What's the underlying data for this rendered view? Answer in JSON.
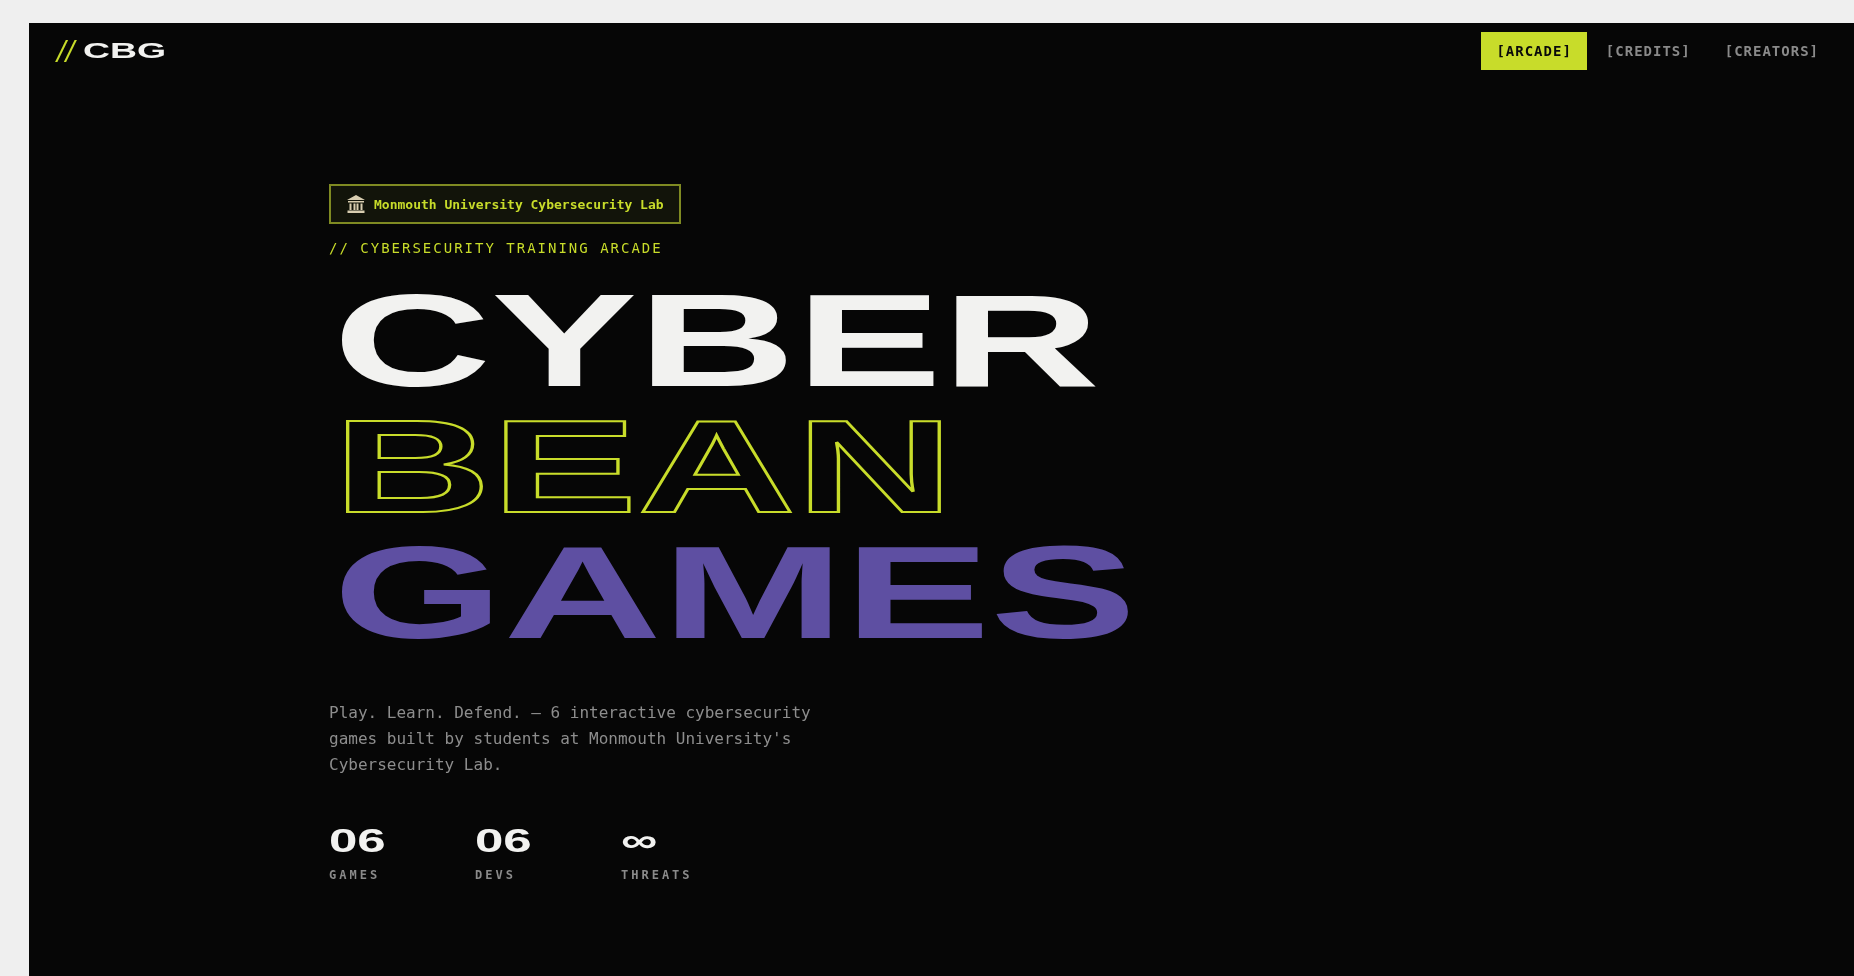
{
  "logo": {
    "mark": "//",
    "text": "CBG"
  },
  "nav": [
    {
      "label": "[ARCADE]",
      "selected": true
    },
    {
      "label": "[CREDITS]",
      "selected": false
    },
    {
      "label": "[CREATORS]",
      "selected": false
    }
  ],
  "badge": {
    "text": "Monmouth University Cybersecurity Lab"
  },
  "eyebrow": "// CYBERSECURITY TRAINING ARCADE",
  "headline": [
    {
      "text": "CYBER",
      "kind": "solid"
    },
    {
      "text": "BEAN",
      "kind": "outline"
    },
    {
      "text": "GAMES",
      "kind": "accent"
    }
  ],
  "description": "Play. Learn. Defend. — 6 interactive cybersecurity games built by students at Monmouth University's Cybersecurity Lab.",
  "stats": [
    {
      "value": "06",
      "label": "GAMES"
    },
    {
      "value": "06",
      "label": "DEVS"
    },
    {
      "value": "∞",
      "label": "THREATS"
    }
  ]
}
